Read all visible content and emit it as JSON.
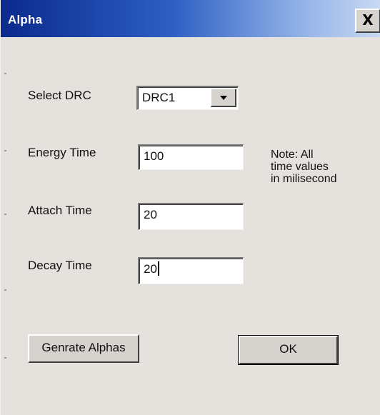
{
  "window": {
    "title": "Alpha",
    "close_glyph": "X"
  },
  "form": {
    "select_drc": {
      "label": "Select DRC",
      "selected": "DRC1"
    },
    "energy_time": {
      "label": "Energy Time",
      "value": "100"
    },
    "attach_time": {
      "label": "Attach Time",
      "value": "20"
    },
    "decay_time": {
      "label": "Decay Time",
      "value": "20"
    },
    "note_lines": [
      "Note: All",
      "time values",
      "in milisecond"
    ]
  },
  "buttons": {
    "generate_label": "Genrate Alphas",
    "ok_label": "OK"
  },
  "icons": {
    "dropdown": "chevron-down-icon",
    "close": "close-icon"
  },
  "colors": {
    "titlebar_start": "#0a2a8c",
    "titlebar_end": "#c9d9f3",
    "dialog_bg": "#e5e2dd"
  }
}
